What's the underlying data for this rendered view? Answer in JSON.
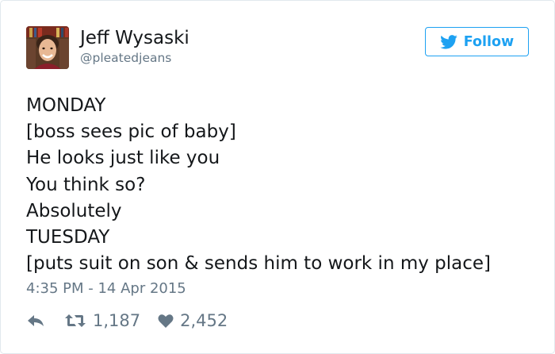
{
  "author": {
    "display_name": "Jeff Wysaski",
    "handle": "@pleatedjeans"
  },
  "follow_button": {
    "label": "Follow",
    "icon": "twitter-bird-icon",
    "color": "#1da1f2"
  },
  "tweet": {
    "lines": [
      "MONDAY",
      "[boss sees pic of baby]",
      "He looks just like you",
      "You think so?",
      "Absolutely",
      "TUESDAY",
      "[puts suit on son & sends him to work in my place]"
    ],
    "timestamp": "4:35 PM - 14 Apr 2015"
  },
  "actions": {
    "reply_icon": "reply-icon",
    "retweet_icon": "retweet-icon",
    "like_icon": "heart-icon",
    "retweets": "1,187",
    "likes": "2,452"
  }
}
